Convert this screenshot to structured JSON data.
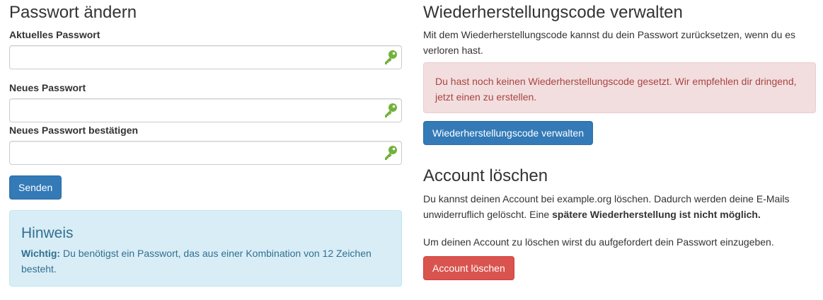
{
  "password_section": {
    "title": "Passwort ändern",
    "fields": [
      {
        "label": "Aktuelles Passwort",
        "value": "",
        "icon": "key-icon"
      },
      {
        "label": "Neues Passwort",
        "value": "",
        "icon": "key-icon"
      },
      {
        "label": "Neues Passwort bestätigen",
        "value": "",
        "icon": "key-icon"
      }
    ],
    "submit_label": "Senden"
  },
  "hint": {
    "title": "Hinweis",
    "strong": "Wichtig:",
    "text": " Du benötigst ein Passwort, das aus einer Kombination von 12 Zeichen besteht."
  },
  "recovery_section": {
    "title": "Wiederherstellungscode verwalten",
    "description": "Mit dem Wiederherstellungscode kannst du dein Passwort zurücksetzen, wenn du es verloren hast.",
    "alert": "Du hast noch keinen Wiederherstellungscode gesetzt. Wir empfehlen dir dringend, jetzt einen zu erstellen.",
    "button_label": "Wiederherstellungscode verwalten"
  },
  "delete_section": {
    "title": "Account löschen",
    "description_plain": "Du kannst deinen Account bei example.org löschen. Dadurch werden deine E-Mails unwiderruflich gelöscht. Eine ",
    "description_strong": "spätere Wiederherstellung ist nicht möglich.",
    "instruction": "Um deinen Account zu löschen wirst du aufgefordert dein Passwort einzugeben.",
    "button_label": "Account löschen"
  },
  "colors": {
    "primary": "#337ab7",
    "danger": "#d9534f",
    "info_bg": "#d9edf7",
    "info_text": "#31708f",
    "alert_bg": "#f2dede",
    "alert_text": "#a94442",
    "key_icon": "#72b23b"
  }
}
